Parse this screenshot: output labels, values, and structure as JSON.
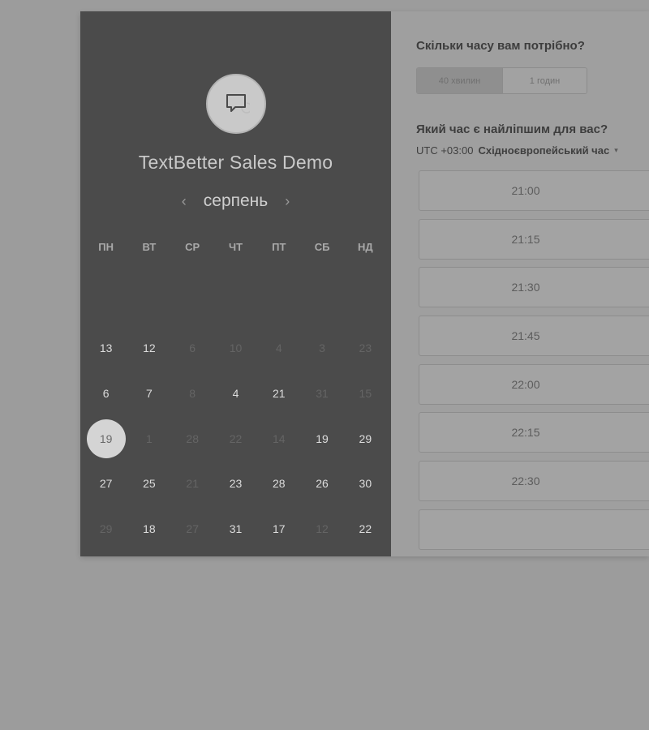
{
  "calendar": {
    "company_title": "TextBetter Sales Demo",
    "month": "серпень",
    "prev_arrow": "‹",
    "next_arrow": "›",
    "weekdays": [
      "ПН",
      "ВТ",
      "СР",
      "ЧТ",
      "ПТ",
      "СБ",
      "НД"
    ],
    "weeks": [
      [
        {
          "d": "",
          "s": "empty"
        },
        {
          "d": "",
          "s": "empty"
        },
        {
          "d": "",
          "s": "empty"
        },
        {
          "d": "",
          "s": "empty"
        },
        {
          "d": "",
          "s": "empty"
        },
        {
          "d": "",
          "s": "empty"
        },
        {
          "d": "",
          "s": "empty"
        }
      ],
      [
        {
          "d": "13",
          "s": "active"
        },
        {
          "d": "12",
          "s": "active"
        },
        {
          "d": "6",
          "s": "inactive"
        },
        {
          "d": "10",
          "s": "inactive"
        },
        {
          "d": "4",
          "s": "inactive"
        },
        {
          "d": "3",
          "s": "inactive"
        },
        {
          "d": "23",
          "s": "inactive"
        }
      ],
      [
        {
          "d": "6",
          "s": "active"
        },
        {
          "d": "7",
          "s": "active"
        },
        {
          "d": "8",
          "s": "inactive"
        },
        {
          "d": "4",
          "s": "active"
        },
        {
          "d": "21",
          "s": "active"
        },
        {
          "d": "31",
          "s": "inactive"
        },
        {
          "d": "15",
          "s": "inactive"
        }
      ],
      [
        {
          "d": "19",
          "s": "selected"
        },
        {
          "d": "1",
          "s": "inactive"
        },
        {
          "d": "28",
          "s": "inactive"
        },
        {
          "d": "22",
          "s": "inactive"
        },
        {
          "d": "14",
          "s": "inactive"
        },
        {
          "d": "19",
          "s": "active"
        },
        {
          "d": "29",
          "s": "active"
        }
      ],
      [
        {
          "d": "27",
          "s": "active"
        },
        {
          "d": "25",
          "s": "active"
        },
        {
          "d": "21",
          "s": "inactive"
        },
        {
          "d": "23",
          "s": "active"
        },
        {
          "d": "28",
          "s": "active"
        },
        {
          "d": "26",
          "s": "active"
        },
        {
          "d": "30",
          "s": "active"
        }
      ],
      [
        {
          "d": "29",
          "s": "inactive"
        },
        {
          "d": "18",
          "s": "active"
        },
        {
          "d": "27",
          "s": "inactive"
        },
        {
          "d": "31",
          "s": "active"
        },
        {
          "d": "17",
          "s": "active"
        },
        {
          "d": "12",
          "s": "inactive"
        },
        {
          "d": "22",
          "s": "active"
        }
      ]
    ]
  },
  "scheduler": {
    "duration_title": "Скільки часу вам потрібно?",
    "duration_options": [
      "40 хвилин",
      "1 годин"
    ],
    "time_title": "Який час є найліпшим для вас?",
    "timezone_offset": "UTC +03:00",
    "timezone_name": "Східноєвропейський час",
    "timezone_caret": "▾",
    "slots": [
      "21:00",
      "21:15",
      "21:30",
      "21:45",
      "22:00",
      "22:15",
      "22:30",
      ""
    ]
  },
  "icons": {
    "avatar": "chat-bubble-icon"
  }
}
